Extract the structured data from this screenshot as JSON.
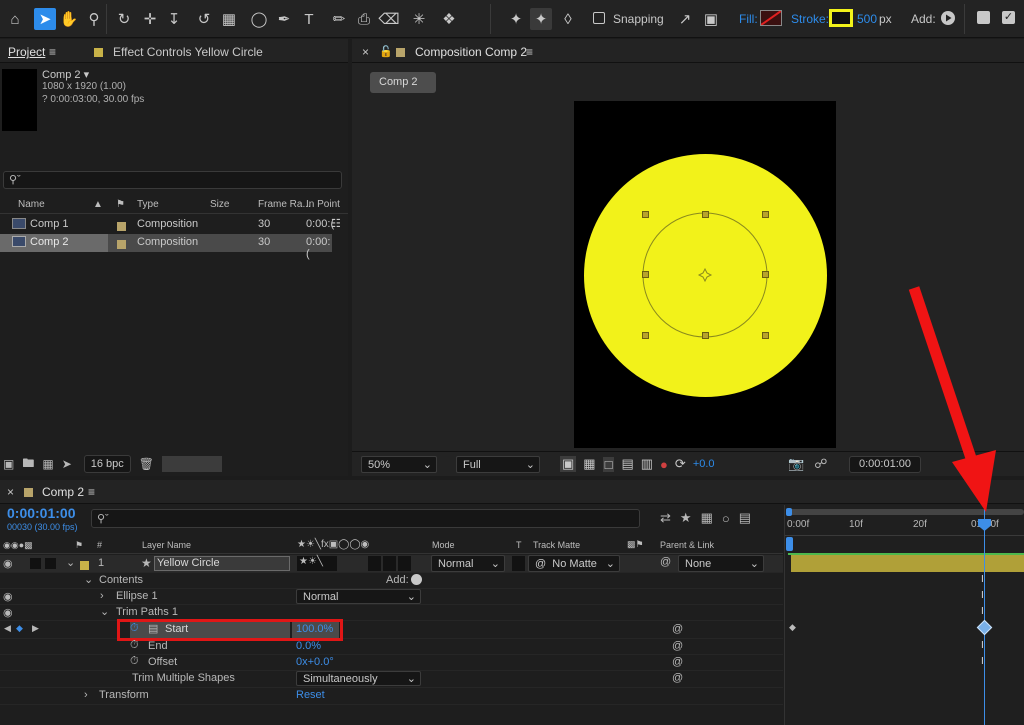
{
  "toolbar": {
    "snapping_label": "Snapping",
    "fill_label": "Fill:",
    "stroke_label": "Stroke:",
    "stroke_width": "500",
    "stroke_unit": "px",
    "add_label": "Add:",
    "colors": {
      "accent": "#2d8ceb",
      "stroke_swatch": "#f2f21a"
    }
  },
  "project": {
    "tab_label": "Project",
    "effect_controls_label": "Effect Controls Yellow Circle",
    "comp_name": "Comp 2",
    "comp_dims": "1080 x 1920 (1.00)",
    "comp_duration": "? 0:00:03:00, 30.00 fps",
    "search_placeholder": "",
    "columns": {
      "name": "Name",
      "type": "Type",
      "size": "Size",
      "frame_rate": "Frame Ra...",
      "in_point": "In Point"
    },
    "items": [
      {
        "name": "Comp 1",
        "type": "Composition",
        "frame_rate": "30",
        "in_point": "0:00:("
      },
      {
        "name": "Comp 2",
        "type": "Composition",
        "frame_rate": "30",
        "in_point": "0:00:("
      }
    ],
    "bpc_label": "16 bpc"
  },
  "composition": {
    "tab_label": "Composition Comp 2",
    "comp_button": "Comp 2",
    "zoom": "50%",
    "resolution": "Full",
    "exposure": "+0.0",
    "timecode": "0:00:01:00",
    "circle_color": "#f2f21a"
  },
  "timeline": {
    "tab_label": "Comp 2",
    "current_time": "0:00:01:00",
    "frame_info": "00030 (30.00 fps)",
    "columns": {
      "num": "#",
      "layer_name": "Layer Name",
      "mode": "Mode",
      "t": "T",
      "track_matte": "Track Matte",
      "parent_link": "Parent & Link"
    },
    "layer": {
      "index": "1",
      "name": "Yellow Circle",
      "mode": "Normal",
      "track_matte": "No Matte",
      "parent": "None"
    },
    "contents_label": "Contents",
    "contents_add": "Add:",
    "ellipse_label": "Ellipse 1",
    "ellipse_mode": "Normal",
    "trim_paths_label": "Trim Paths 1",
    "start_label": "Start",
    "start_value": "100.0%",
    "end_label": "End",
    "end_value": "0.0%",
    "offset_label": "Offset",
    "offset_value": "0x+0.0°",
    "trim_multiple_label": "Trim Multiple Shapes",
    "trim_multiple_value": "Simultaneously",
    "transform_label": "Transform",
    "transform_reset": "Reset",
    "ruler": [
      "0:00f",
      "10f",
      "20f",
      "01:00f"
    ]
  }
}
